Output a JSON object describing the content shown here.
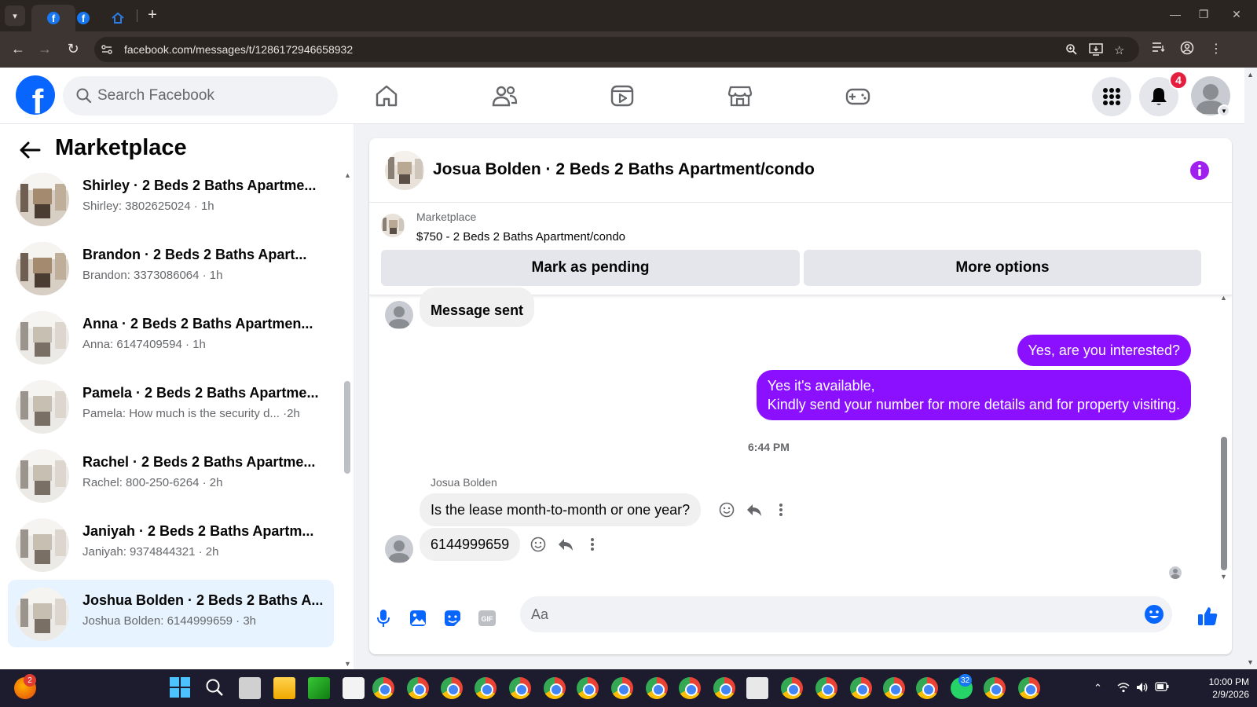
{
  "browser": {
    "url": "facebook.com/messages/t/1286172946658932"
  },
  "header": {
    "search_placeholder": "Search Facebook",
    "notification_count": "4"
  },
  "sidebar": {
    "title": "Marketplace",
    "conversations": [
      {
        "name": "Shirley · 2 Beds 2 Baths Apartme...",
        "snippet": "Shirley: 3802625024 · 1h"
      },
      {
        "name": "Brandon · 2 Beds 2 Baths Apart...",
        "snippet": "Brandon: 3373086064 · 1h"
      },
      {
        "name": "Anna · 2 Beds 2 Baths Apartmen...",
        "snippet": "Anna: 6147409594 · 1h"
      },
      {
        "name": "Pamela · 2 Beds 2 Baths Apartme...",
        "snippet": "Pamela: How much is the security d...  ·2h"
      },
      {
        "name": "Rachel · 2 Beds 2 Baths Apartme...",
        "snippet": "Rachel: 800-250-6264 · 2h"
      },
      {
        "name": "Janiyah · 2 Beds 2 Baths Apartm...",
        "snippet": "Janiyah: 9374844321 · 2h"
      },
      {
        "name": "Joshua Bolden · 2 Beds 2 Baths A...",
        "snippet": "Joshua Bolden: 6144999659 · 3h"
      }
    ]
  },
  "chat": {
    "title": "Josua Bolden · 2 Beds 2 Baths Apartment/condo",
    "listing_label": "Marketplace",
    "listing_title": "$750 - 2 Beds 2 Baths Apartment/condo",
    "mark_pending_label": "Mark as pending",
    "more_options_label": "More options",
    "messages": {
      "m1": "Message sent",
      "m2": "Yes, are you interested?",
      "m3_line1": "Yes it's available,",
      "m3_line2": "Kindly send your number for more details and for property visiting.",
      "time": "6:44 PM",
      "sender": "Josua Bolden",
      "m4": "Is the lease month-to-month or one year?",
      "m5": "6144999659"
    },
    "composer_placeholder": "Aa"
  },
  "taskbar": {
    "firefox_badge": "2",
    "whatsapp_badge": "32",
    "time": "10:00 PM",
    "date": "2/9/2026"
  },
  "colors": {
    "fb_blue": "#0866ff",
    "outgoing_bubble": "#8a10ff",
    "active_conversation": "#e7f3ff"
  }
}
